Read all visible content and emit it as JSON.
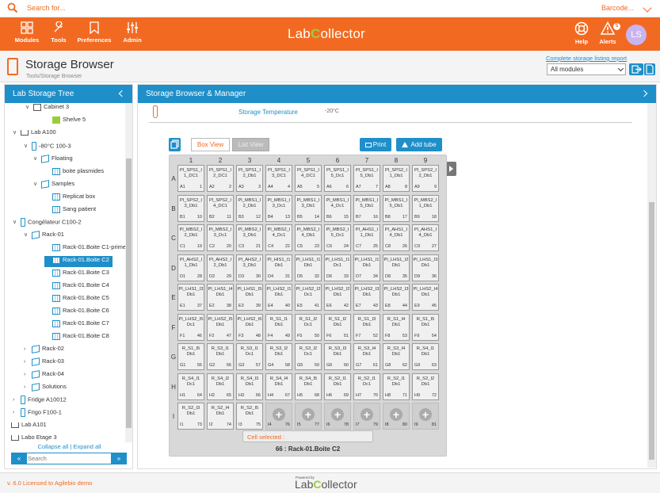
{
  "topbar": {
    "search_placeholder": "Search for...",
    "barcode": "Barcode..."
  },
  "nav": {
    "modules": "Modules",
    "tools": "Tools",
    "preferences": "Preferences",
    "admin": "Admin",
    "logo_left": "Lab",
    "logo_c": "C",
    "logo_right": "ollector",
    "help": "Help",
    "alerts": "Alerts",
    "alerts_count": "5",
    "avatar": "LS"
  },
  "header": {
    "title": "Storage Browser",
    "breadcrumb": "Tools/Storage Browser",
    "report_link": "Complete storage listing report",
    "module_select": "All modules"
  },
  "tree": {
    "title": "Lab Storage Tree",
    "nodes": [
      "Cabinet 3",
      "Shelve 5",
      "Lab A100",
      "-80°C 100-3",
      "Floating",
      "boite plasmides",
      "Samples",
      "Replicat box",
      "Sang patient",
      "Congélateur C100-2",
      "Rack-01",
      "Rack-01.Boite C1-prime",
      "Rack-01.Boite C2",
      "Rack-01.Boite C3",
      "Rack-01.Boite C4",
      "Rack-01.Boite C5",
      "Rack-01.Boite C6",
      "Rack-01.Boite C7",
      "Rack-01.Boite C8",
      "Rack-02",
      "Rack-03",
      "Rack-04",
      "Solutions",
      "Fridge A10012",
      "Frigo F100-1",
      "Lab A101",
      "Labo Etage 3"
    ],
    "collapse": "Collapse all",
    "expand": "Expand all",
    "search_placeholder": "Search"
  },
  "main": {
    "title": "Storage Browser & Manager",
    "temp_label": "Storage Temperature",
    "temp_value": "-20°C",
    "box_view": "Box View",
    "list_view": "List View",
    "print": "Print",
    "add_tube": "Add tube",
    "cell_selected": "Cell selected :",
    "rack_name": "66 : Rack-01.Boite C2"
  },
  "grid": {
    "cols": [
      "1",
      "2",
      "3",
      "4",
      "5",
      "6",
      "7",
      "8",
      "9"
    ],
    "rows": [
      "A",
      "B",
      "C",
      "D",
      "E",
      "F",
      "G",
      "H",
      "I"
    ],
    "cells": [
      [
        "Pl_SPS1_I 1_DC1",
        "Pl_SPS1_I 2_DC1",
        "Pl_SPS1_I 2_Db1",
        "Pl_SPS1_I 3_DC1",
        "Pl_SPS1_I 4_DC1",
        "Pl_SPS1_I 5_Dc1",
        "Pl_SPS1_I 5_Db1",
        "Pl_SPS2_I 1_Db1",
        "Pl_SPS2_I 2_Db1"
      ],
      [
        "Pl_SPS2_I 3_Db1",
        "Pl_SPS2_I 4_DC1",
        "Pl_MBS1_I 2_Db1",
        "Pl_MBS1_I 3_Dc1",
        "Pl_MBS1_I 3_Db1",
        "Pl_MBS1_I 4_Dc1",
        "Pl_MBS1_I 5_Db1",
        "Pl_MBS1_I 5_Db1",
        "Pl_MBS2_I 1_Db1"
      ],
      [
        "Pl_MBS2_I 2_Db1",
        "Pl_MBS2_I 3_Dc1",
        "Pl_MBS2_I 3_Db1",
        "Pl_MBS2_I 4_Dc1",
        "Pl_MBS2_I 4_Db1",
        "Pl_MBS2_I 5_Dc1",
        "Pl_AHS1_I 1_Db1",
        "Pl_AHS1_I 4_Db1",
        "Pl_AHS1_I 4_Db1"
      ],
      [
        "Pl_AHS2_I 1_Db1",
        "Pl_AHS2_I 2_Db1",
        "Pl_AHS2_I 3_Db1",
        "Pl_HIS1_I1 Db1",
        "Pl_LHS1_I1 Db1",
        "Pl_LHS1_I1 Dc1",
        "Pl_LHS1_I1 Db1",
        "Pl_LHS1_I2 Db1",
        "Pl_LHS1_I3 Db1"
      ],
      [
        "Pl_LHS1_I3 Db1",
        "Pl_LHS1_I4 Db1",
        "Pl_LHS1_I5 Db1",
        "Pl_LHS2_I1 Db1",
        "Pl_LHS2_I2 Dc1",
        "Pl_LHS2_I2 Db1",
        "Pl_LHS2_I3 Db1",
        "Pl_LHS2_I3 Db1",
        "Pl_LHS2_I4 Db1"
      ],
      [
        "Pl_LHS2_I5 Dc1",
        "Pl_LHS2_I5 Db1",
        "Pl_LHS2_I6 Db1",
        "R_S1_I1 Db1",
        "R_S1_I2 Dc1",
        "R_S1_I2 Db1",
        "R_S1_I3 Db1",
        "R_S1_I4 Db1",
        "R_S1_I5 Db1"
      ],
      [
        "R_S1_I5 Db1",
        "R_S3_I1 Db1",
        "R_S3_I1 Dc1",
        "R_S3_I2 Db1",
        "R_S3_I2 Dc1",
        "R_S3_I3 Db1",
        "R_S3_I4 Db1",
        "R_S3_I4 Db1",
        "R_S4_I1 Db1"
      ],
      [
        "R_S4_I1 Dc1",
        "R_S4_I2 Db1",
        "R_S4_I3 Db1",
        "R_S4_I4 Db1",
        "R_S4_I5 Db1",
        "R_S2_I1 Db1",
        "R_S2_I1 Dc1",
        "R_S2_I1 Db1",
        "R_S2_I2 Db1"
      ],
      [
        "R_S2_I3 Db1",
        "R_S2_I4 Db1",
        "R_S2_I5 Db1",
        "",
        "",
        "",
        "",
        "",
        ""
      ]
    ]
  },
  "footer": {
    "license": "v. 6.0 Licensed to Agilebio demo",
    "powered": "Powered by"
  }
}
